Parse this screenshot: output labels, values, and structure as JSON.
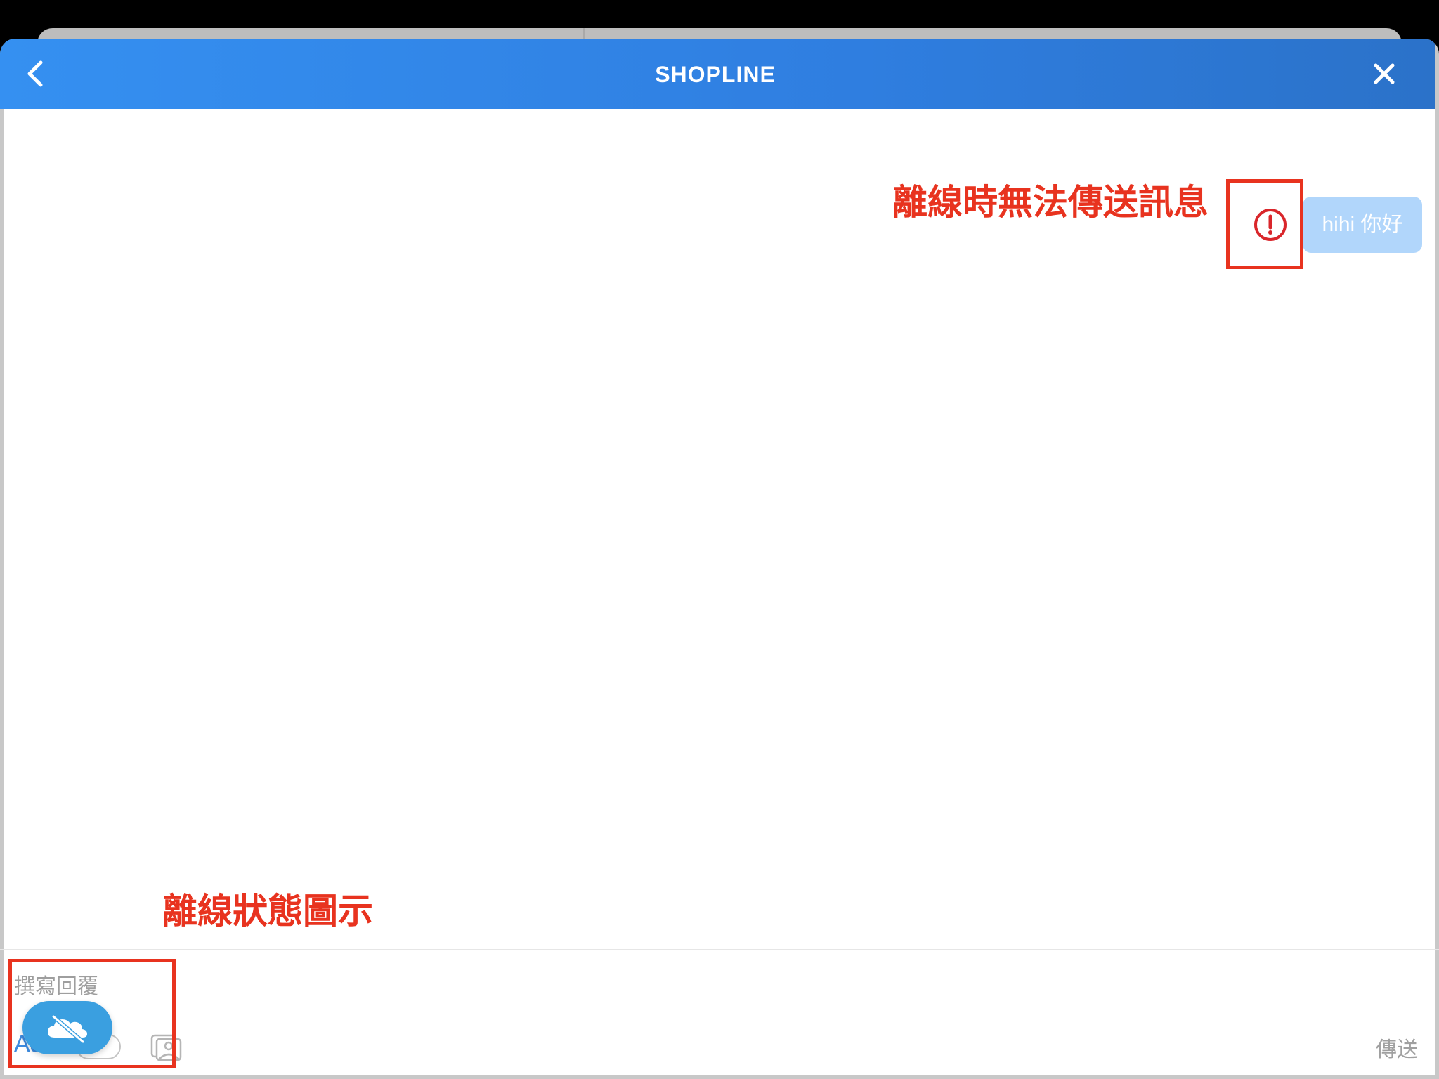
{
  "header": {
    "title": "SHOPLINE",
    "back_icon": "chevron-left-icon",
    "close_icon": "close-icon"
  },
  "messages": [
    {
      "text": "hihi 你好",
      "status_icon": "error-exclamation-icon"
    }
  ],
  "annotations": {
    "offline_send_failure": "離線時無法傳送訊息",
    "offline_status_icon": "離線狀態圖示"
  },
  "composer": {
    "placeholder": "撰寫回覆",
    "partial_label": "Aa",
    "send_label": "傳送",
    "offline_icon": "cloud-offline-icon",
    "image_icon": "image-icon"
  },
  "colors": {
    "header_start": "#3590f1",
    "header_end": "#2b72c9",
    "annotation_red": "#e8331f",
    "bubble_bg": "#b1d6fb",
    "fab_bg": "#3a9fe0",
    "error_red": "#d9262b"
  }
}
